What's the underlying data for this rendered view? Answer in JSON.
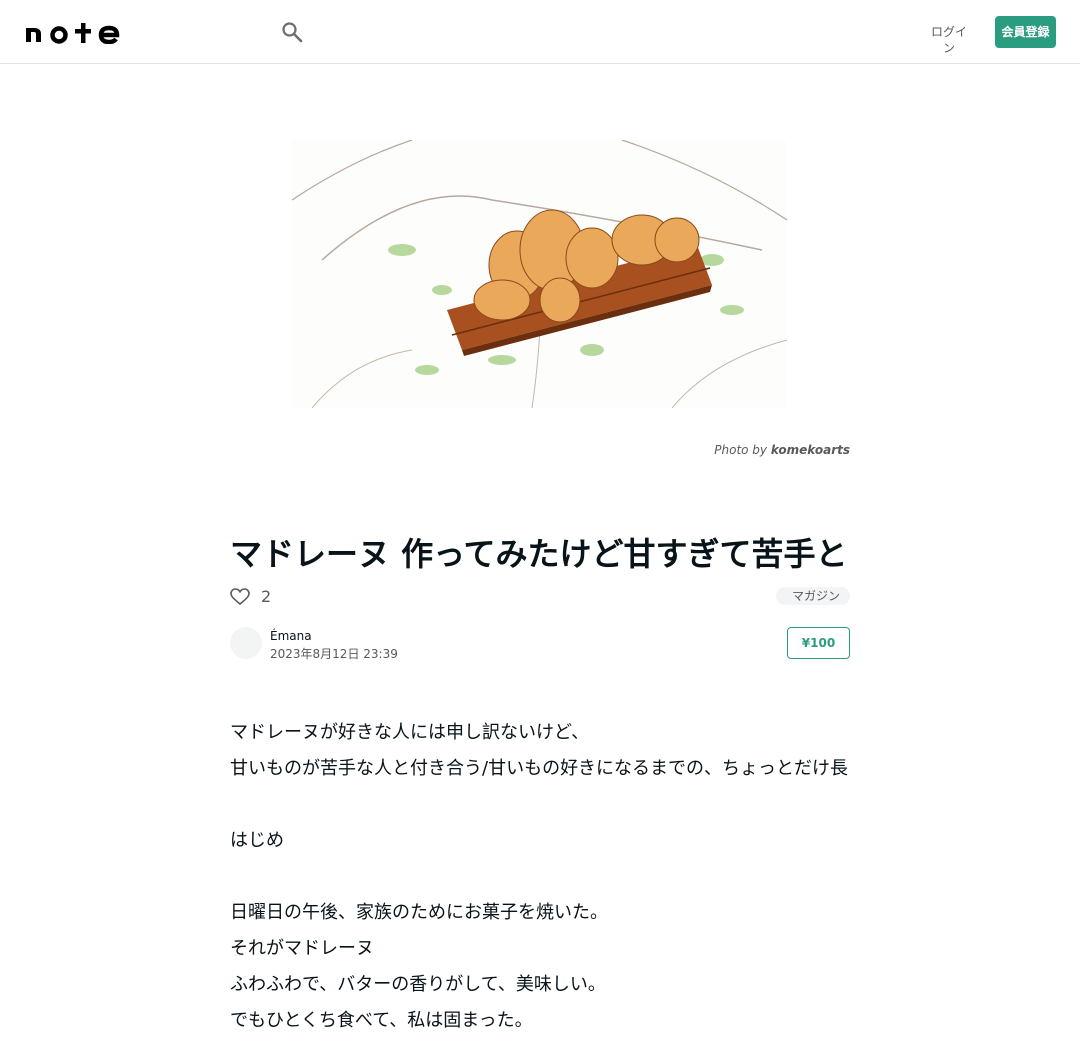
{
  "header": {
    "logo_text": "note",
    "login_label": "ログイン",
    "signup_label": "会員登録"
  },
  "hero": {
    "credit_prefix": "Photo by",
    "credit_author": "komekoarts"
  },
  "article": {
    "title": "マドレーヌ 作ってみたけど甘すぎて苦手という話になった",
    "like_count": "2",
    "badge": "マガジン",
    "author": "Émana",
    "date": "2023年8月12日 23:39",
    "price": "¥100",
    "paragraphs": [
      "マドレーヌが好きな人には申し訳ないけど、",
      "甘いものが苦手な人と付き合う/甘いもの好きになるまでの、ちょっとだけ長い話をしてみます。",
      "",
      "はじめ",
      "",
      "日曜日の午後、家族のためにお菓子を焼いた。",
      "それがマドレーヌ",
      "ふわふわで、バターの香りがして、美味しい。",
      "でもひとくち食べて、私は固まった。"
    ]
  },
  "icons": {
    "search": "search-icon",
    "like": "heart-icon"
  },
  "colors": {
    "accent": "#2a9c7f",
    "text": "#08131a",
    "muted": "#57595a"
  }
}
